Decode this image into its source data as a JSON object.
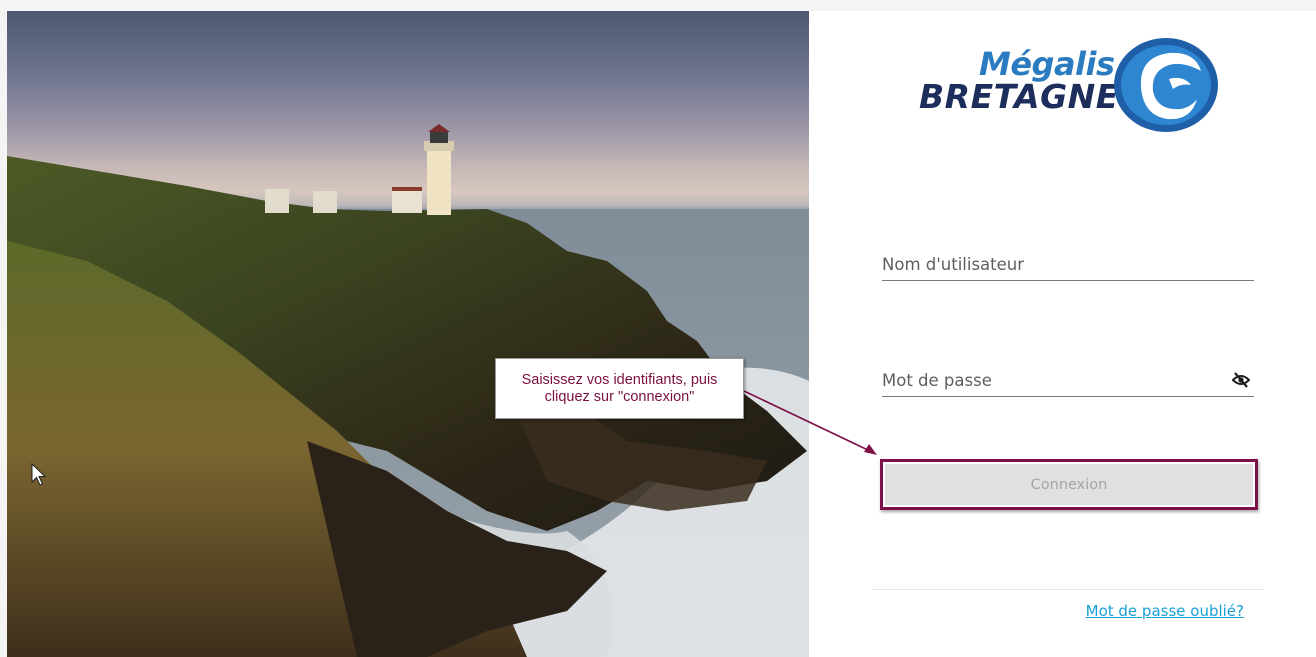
{
  "login": {
    "username_placeholder": "Nom d'utilisateur",
    "password_placeholder": "Mot de passe",
    "connect_label": "Connexion",
    "forgot_label": "Mot de passe oublié?"
  },
  "logo": {
    "line1": "Mégalis",
    "line2": "BRETAGNE"
  },
  "annotation": {
    "text": "Saisissez vos identifiants, puis cliquez sur \"connexion\""
  },
  "icons": {
    "password_toggle": "eye-slash-icon",
    "logo_mark": "swirl-globe-icon",
    "pointer": "mouse-cursor-icon"
  },
  "colors": {
    "annotation_accent": "#7d1048",
    "link": "#1aa0d6",
    "logo_blue": "#2a7bbf",
    "logo_navy": "#1d2d5c",
    "button_bg": "#e0e0e0"
  }
}
